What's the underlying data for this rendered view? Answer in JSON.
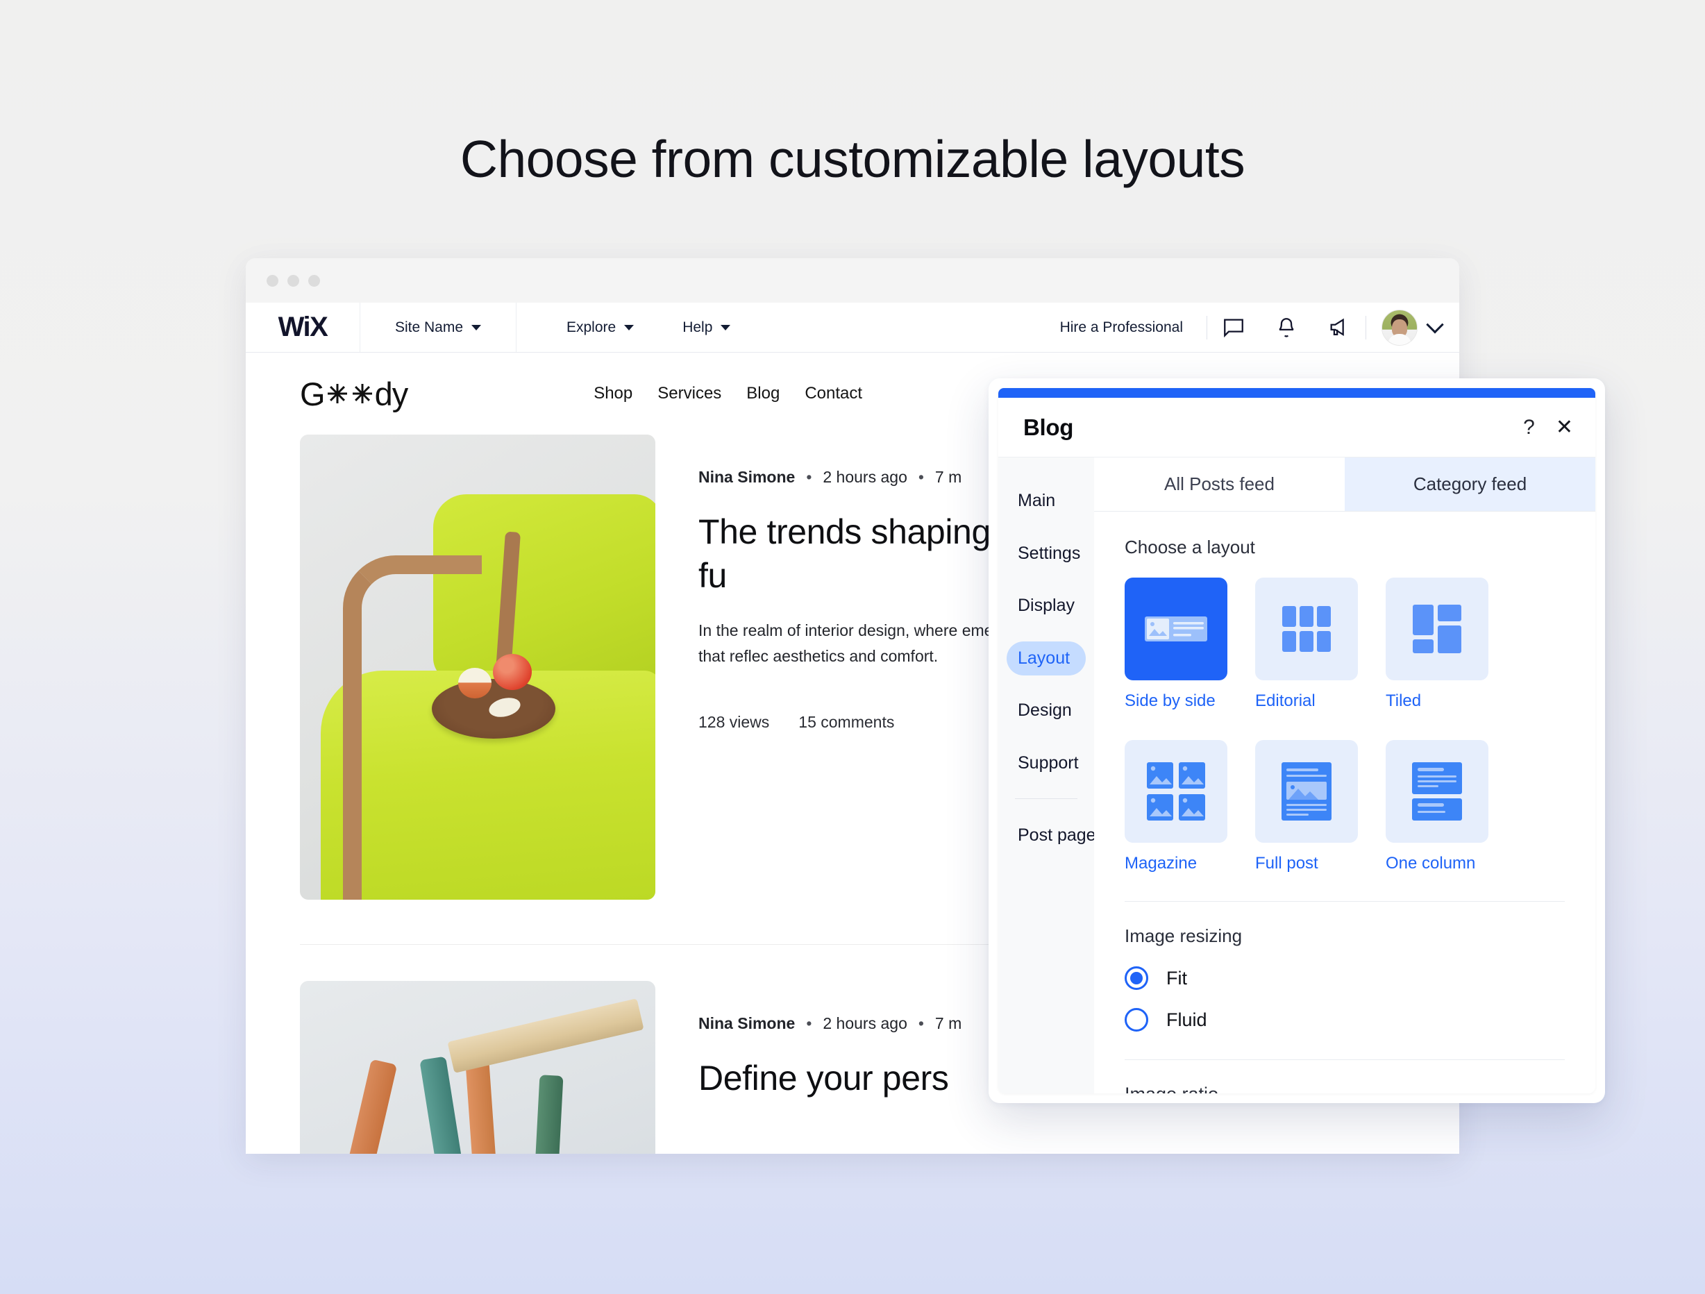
{
  "hero": {
    "title": "Choose from customizable layouts"
  },
  "browser": {
    "dots": 3
  },
  "topbar": {
    "logo": "WiX",
    "site_name": "Site Name",
    "menus": [
      "Explore",
      "Help"
    ],
    "hire_pro": "Hire a Professional",
    "icons": [
      "chat-icon",
      "bell-icon",
      "megaphone-icon"
    ],
    "avatar": "user-avatar",
    "account_caret": "chevron-down-icon"
  },
  "site": {
    "logo": "Goody",
    "nav": [
      "Shop",
      "Services",
      "Blog",
      "Contact"
    ],
    "posts": [
      {
        "author": "Nina Simone",
        "time": "2 hours ago",
        "read": "7 m",
        "title": "The trends shaping contemporary fu",
        "excerpt": "In the realm of interior design, where emerged as iconic pieces that reflec aesthetics and comfort.",
        "views": "128 views",
        "comments": "15 comments",
        "image": "green-chair-with-apples-photo"
      },
      {
        "author": "Nina Simone",
        "time": "2 hours ago",
        "read": "7 m",
        "title": "Define your pers",
        "image": "colorful-stool-legs-photo"
      }
    ]
  },
  "panel": {
    "title": "Blog",
    "help_label": "?",
    "close_label": "✕",
    "sidebar": {
      "items": [
        "Main",
        "Settings",
        "Display",
        "Layout",
        "Design",
        "Support"
      ],
      "active": "Layout",
      "footer_item": "Post page"
    },
    "tabs": [
      {
        "label": "All Posts feed",
        "active": false
      },
      {
        "label": "Category feed",
        "active": true
      }
    ],
    "choose_layout_label": "Choose a layout",
    "layouts": [
      {
        "name": "Side by side",
        "icon": "side-by-side-layout-icon",
        "selected": true
      },
      {
        "name": "Editorial",
        "icon": "editorial-layout-icon",
        "selected": false
      },
      {
        "name": "Tiled",
        "icon": "tiled-layout-icon",
        "selected": false
      },
      {
        "name": "Magazine",
        "icon": "magazine-layout-icon",
        "selected": false
      },
      {
        "name": "Full post",
        "icon": "full-post-layout-icon",
        "selected": false
      },
      {
        "name": "One column",
        "icon": "one-column-layout-icon",
        "selected": false
      }
    ],
    "image_resizing_label": "Image resizing",
    "resize_options": [
      {
        "label": "Fit",
        "selected": true
      },
      {
        "label": "Fluid",
        "selected": false
      }
    ],
    "image_ratio_label": "Image ratio"
  },
  "colors": {
    "accent_blue": "#1f63f7",
    "light_blue": "#e6eefc",
    "tab_active_bg": "#e8f0fe",
    "sidebar_active_bg": "#c5dcff",
    "page_bg_top": "#f0f0ef",
    "page_bg_bottom": "#d6ddf5"
  }
}
